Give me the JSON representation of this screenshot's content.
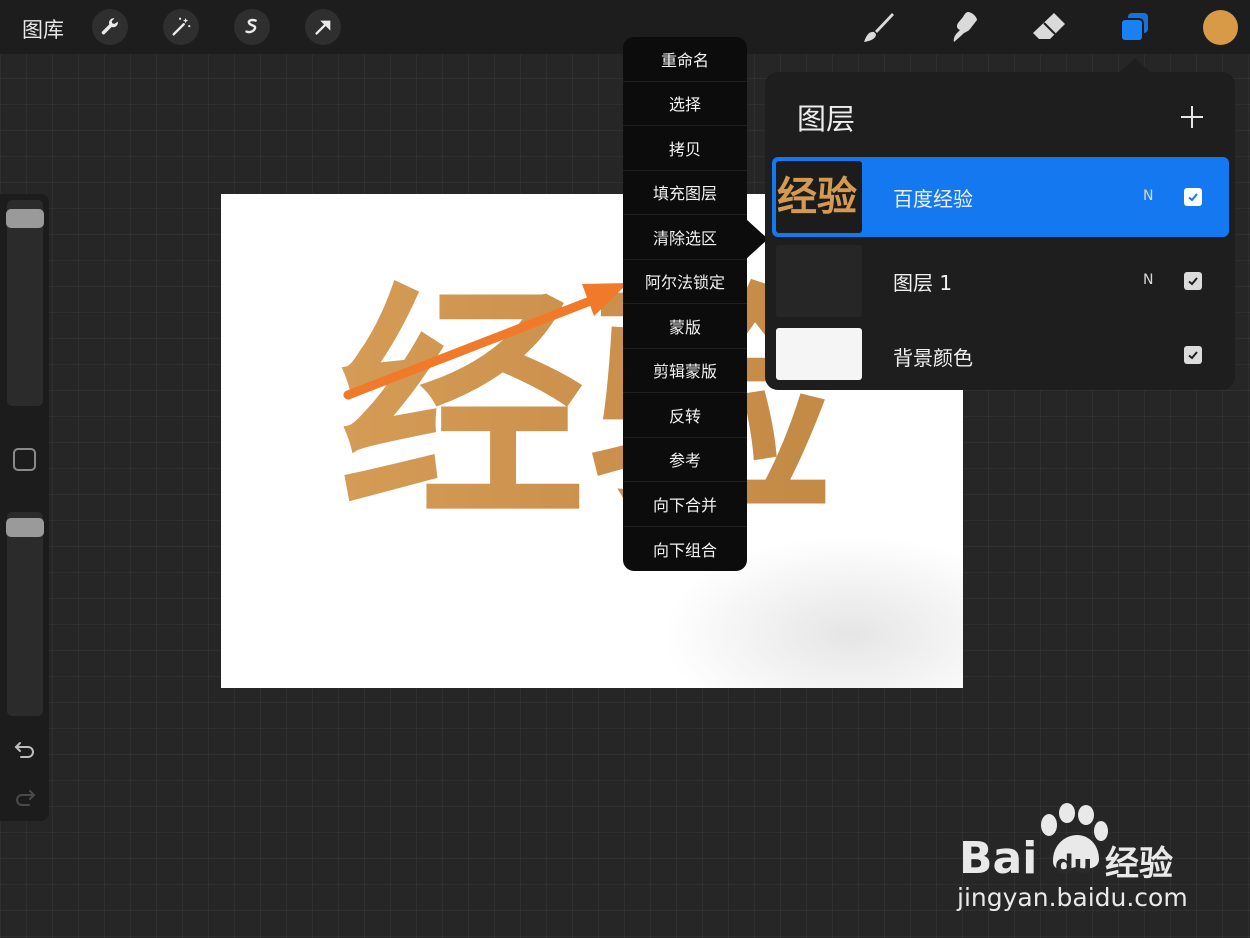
{
  "toolbar": {
    "gallery_label": "图库",
    "left_tools": [
      "wrench-icon",
      "magic-wand-icon",
      "selection-icon",
      "transform-arrow-icon"
    ],
    "right_tools": [
      "brush-icon",
      "smudge-icon",
      "eraser-icon",
      "layers-icon"
    ],
    "active_tool": "layers",
    "current_color": "#d99a47"
  },
  "sidebar": {
    "brush_size_level": 0.95,
    "opacity_level": 0.97,
    "controls": [
      "modify-button",
      "undo-icon",
      "redo-icon"
    ]
  },
  "canvas": {
    "text": "经验",
    "text_color": "#cf9650",
    "background": "#ffffff"
  },
  "layer_menu": {
    "items": [
      "重命名",
      "选择",
      "拷贝",
      "填充图层",
      "清除选区",
      "阿尔法锁定",
      "蒙版",
      "剪辑蒙版",
      "反转",
      "参考",
      "向下合并",
      "向下组合"
    ],
    "highlighted_by_arrow": "阿尔法锁定"
  },
  "layers_panel": {
    "title": "图层",
    "add_icon": "plus-icon",
    "layers": [
      {
        "name": "百度经验",
        "blend_mode": "N",
        "visible": true,
        "selected": true,
        "thumb_text": "经验"
      },
      {
        "name": "图层 1",
        "blend_mode": "N",
        "visible": true,
        "selected": false
      },
      {
        "name": "背景颜色",
        "blend_mode": "",
        "visible": true,
        "selected": false
      }
    ]
  },
  "annotation": {
    "arrow_color": "#f07a2a"
  },
  "watermark": {
    "brand": "Bai",
    "brand_du": "du",
    "brand_suffix": "经验",
    "url": "jingyan.baidu.com"
  },
  "colors": {
    "accent_blue": "#1478f0",
    "panel_bg": "#1e1e1e",
    "menu_bg": "#0c0c0c"
  }
}
